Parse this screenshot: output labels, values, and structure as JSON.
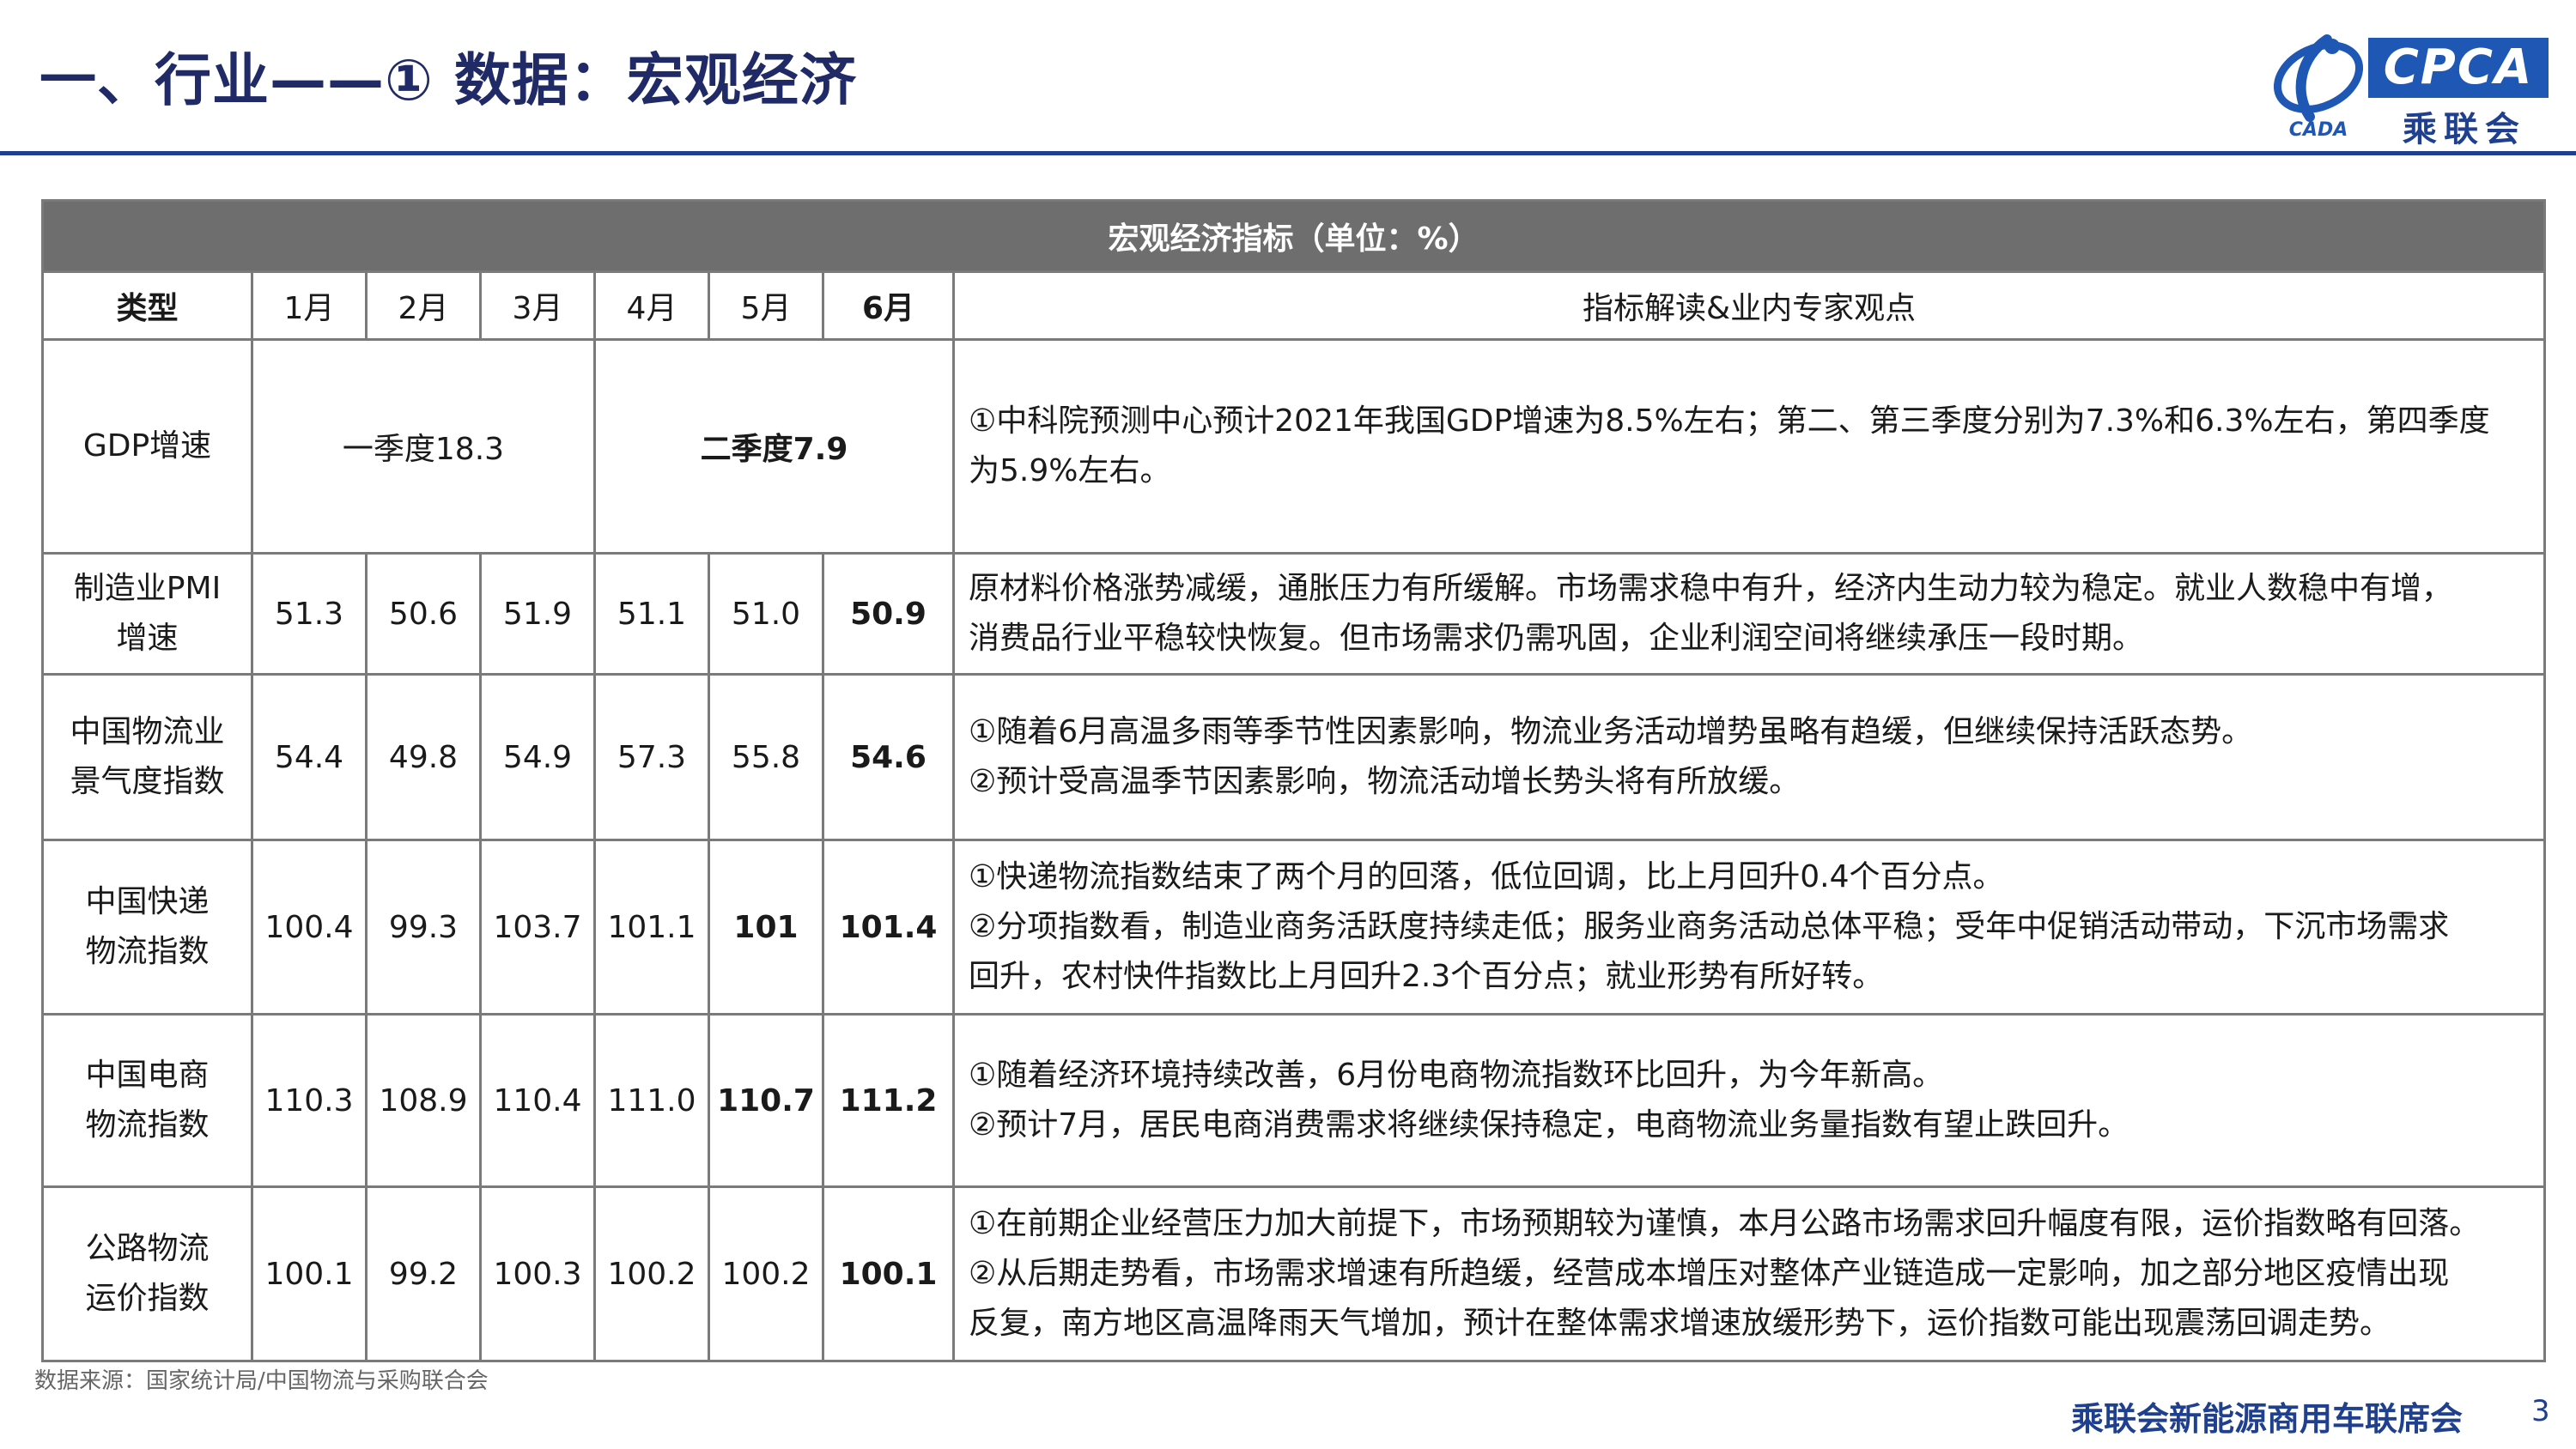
{
  "header": {
    "title": "一、行业——① 数据：宏观经济"
  },
  "logo": {
    "mark_text": "CADA",
    "brand_en": "CPCA",
    "brand_cn": "乘联会"
  },
  "table": {
    "caption": "宏观经济指标（单位：%）",
    "columns": [
      "类型",
      "1月",
      "2月",
      "3月",
      "4月",
      "5月",
      "6月",
      "指标解读&业内专家观点"
    ],
    "rows": [
      {
        "label_lines": [
          "GDP增速"
        ],
        "q1": "一季度18.3",
        "q2": "二季度7.9",
        "desc_lines": [
          "①中科院预测中心预计2021年我国GDP增速为8.5%左右；第二、第三季度分别为7.3%和6.3%左右，第四季度",
          "为5.9%左右。"
        ]
      },
      {
        "label_lines": [
          "制造业PMI",
          "增速"
        ],
        "values": [
          "51.3",
          "50.6",
          "51.9",
          "51.1",
          "51.0",
          "50.9"
        ],
        "desc_lines": [
          "原材料价格涨势减缓，通胀压力有所缓解。市场需求稳中有升，经济内生动力较为稳定。就业人数稳中有增，",
          "消费品行业平稳较快恢复。但市场需求仍需巩固，企业利润空间将继续承压一段时期。"
        ]
      },
      {
        "label_lines": [
          "中国物流业",
          "景气度指数"
        ],
        "values": [
          "54.4",
          "49.8",
          "54.9",
          "57.3",
          "55.8",
          "54.6"
        ],
        "desc_lines": [
          "①随着6月高温多雨等季节性因素影响，物流业务活动增势虽略有趋缓，但继续保持活跃态势。",
          "②预计受高温季节因素影响，物流活动增长势头将有所放缓。"
        ]
      },
      {
        "label_lines": [
          "中国快递",
          "物流指数"
        ],
        "values": [
          "100.4",
          "99.3",
          "103.7",
          "101.1",
          "101",
          "101.4"
        ],
        "desc_lines": [
          "①快递物流指数结束了两个月的回落，低位回调，比上月回升0.4个百分点。",
          "②分项指数看，制造业商务活跃度持续走低；服务业商务活动总体平稳；受年中促销活动带动，下沉市场需求",
          "回升，农村快件指数比上月回升2.3个百分点；就业形势有所好转。"
        ]
      },
      {
        "label_lines": [
          "中国电商",
          "物流指数"
        ],
        "values": [
          "110.3",
          "108.9",
          "110.4",
          "111.0",
          "110.7",
          "111.2"
        ],
        "desc_lines": [
          "①随着经济环境持续改善，6月份电商物流指数环比回升，为今年新高。",
          "②预计7月，居民电商消费需求将继续保持稳定，电商物流业务量指数有望止跌回升。"
        ]
      },
      {
        "label_lines": [
          "公路物流",
          "运价指数"
        ],
        "values": [
          "100.1",
          "99.2",
          "100.3",
          "100.2",
          "100.2",
          "100.1"
        ],
        "desc_lines": [
          "①在前期企业经营压力加大前提下，市场预期较为谨慎，本月公路市场需求回升幅度有限，运价指数略有回落。",
          "②从后期走势看，市场需求增速有所趋缓，经营成本增压对整体产业链造成一定影响，加之部分地区疫情出现",
          "反复，南方地区高温降雨天气增加，预计在整体需求增速放缓形势下，运价指数可能出现震荡回调走势。"
        ]
      }
    ]
  },
  "footer": {
    "source": "数据来源：国家统计局/中国物流与采购联合会",
    "brand": "乘联会新能源商用车联席会",
    "page": "3"
  },
  "colors": {
    "title": "#1f2a66",
    "rule": "#1f3f8f",
    "caption_bg": "#6e6e6e",
    "logo_blue": "#1f57b4"
  }
}
